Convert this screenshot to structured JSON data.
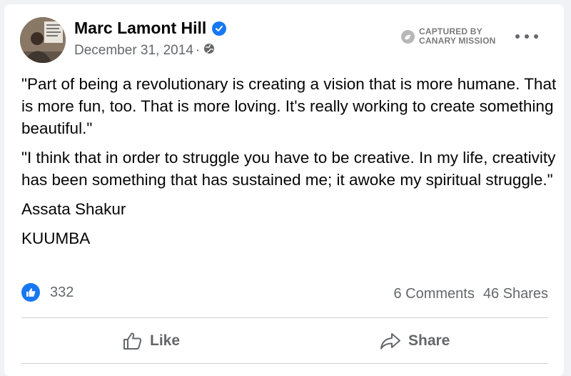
{
  "post": {
    "author_name": "Marc Lamont Hill",
    "date": "December 31, 2014",
    "separator": "·",
    "captured_line1": "CAPTURED BY",
    "captured_line2": "CANARY MISSION",
    "paragraphs": [
      "\"Part of being a revolutionary is creating a vision that is more humane. That is more fun, too. That is more loving. It's really working to create something beautiful.\"",
      "\"I think that in order to struggle you have to be creative. In my life, creativity has been something that has sustained me; it awoke my spiritual struggle.\"",
      "Assata Shakur",
      "KUUMBA"
    ]
  },
  "engagement": {
    "reaction_count": "332",
    "comments": "6 Comments",
    "shares": "46 Shares"
  },
  "actions": {
    "like_label": "Like",
    "share_label": "Share"
  },
  "icons": {
    "verified": "verified-badge-icon",
    "audience": "globe-icon",
    "captured": "canary-mission-icon",
    "more": "more-options-icon",
    "like_reaction": "thumbs-up-icon",
    "like_action": "thumbs-up-outline-icon",
    "share_action": "share-arrow-icon"
  },
  "colors": {
    "brand_blue": "#1877f2",
    "secondary_text": "#65676b",
    "background": "#f0f2f5"
  }
}
